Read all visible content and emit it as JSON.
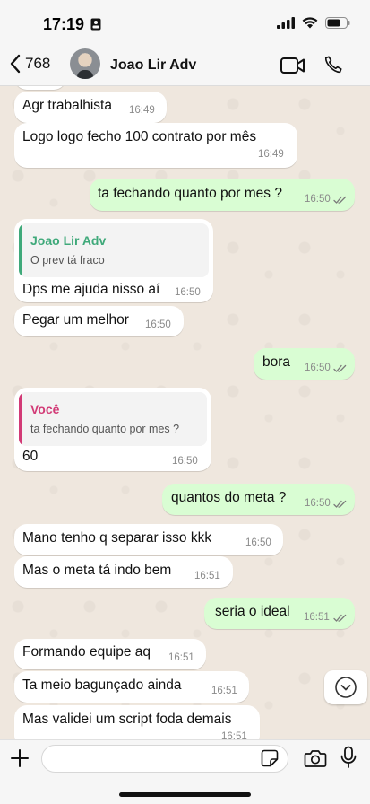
{
  "status_bar": {
    "time": "17:19"
  },
  "header": {
    "back_count": "768",
    "contact_name": "Joao Lir Adv"
  },
  "messages": [
    {
      "text": "Agr trabalhista",
      "time": "16:49"
    },
    {
      "text": "Logo logo fecho 100 contrato por mês",
      "time": "16:49"
    },
    {
      "text": "ta fechando quanto por mes ?",
      "time": "16:50"
    },
    {
      "quote_author": "Joao Lir Adv",
      "quote_text": "O prev tá fraco",
      "text": "Dps me ajuda nisso aí",
      "time": "16:50"
    },
    {
      "text": "Pegar um melhor",
      "time": "16:50"
    },
    {
      "text": "bora",
      "time": "16:50"
    },
    {
      "quote_author": "Você",
      "quote_text": "ta fechando quanto por mes ?",
      "text": "60",
      "time": "16:50"
    },
    {
      "text": "quantos do meta ?",
      "time": "16:50"
    },
    {
      "text": "Mano tenho q separar isso kkk",
      "time": "16:50"
    },
    {
      "text": "Mas o meta tá indo bem",
      "time": "16:51"
    },
    {
      "text": "seria o ideal",
      "time": "16:51"
    },
    {
      "text": "Formando equipe aq",
      "time": "16:51"
    },
    {
      "text": "Ta meio bagunçado ainda",
      "time": "16:51"
    },
    {
      "text": "Mas validei um script foda demais",
      "time": "16:51"
    }
  ],
  "composer": {
    "value": ""
  },
  "colors": {
    "quote_contact": "#3fa97a",
    "quote_self": "#d23a76",
    "ticks": "#7a7a7a"
  },
  "icons": [
    "chevron-left-icon",
    "video-icon",
    "phone-icon",
    "plus-icon",
    "sticker-icon",
    "camera-icon",
    "mic-icon",
    "chevron-down-icon"
  ]
}
